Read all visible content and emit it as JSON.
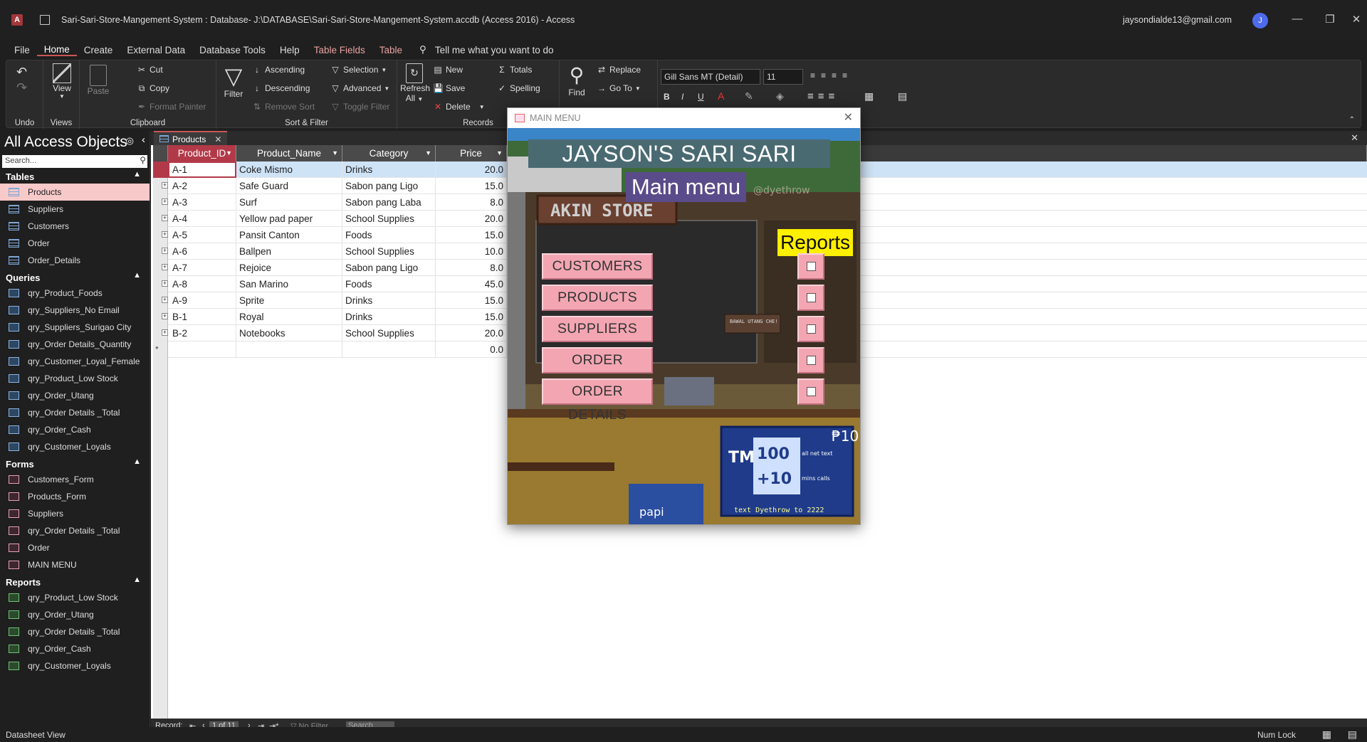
{
  "titlebar": {
    "app_badge": "A",
    "title": "Sari-Sari-Store-Mangement-System : Database- J:\\DATABASE\\Sari-Sari-Store-Mangement-System.accdb (Access 2016)  -  Access",
    "user": "jaysondialde13@gmail.com",
    "avatar": "J"
  },
  "menu": {
    "file": "File",
    "home": "Home",
    "create": "Create",
    "external": "External Data",
    "dbtools": "Database Tools",
    "help": "Help",
    "table_fields": "Table Fields",
    "table": "Table",
    "tell": "Tell me what you want to do"
  },
  "ribbon": {
    "undo_group": "Undo",
    "views_group": "Views",
    "view": "View",
    "clipboard_group": "Clipboard",
    "paste": "Paste",
    "cut": "Cut",
    "copy": "Copy",
    "format_painter": "Format Painter",
    "sortfilter_group": "Sort & Filter",
    "filter": "Filter",
    "ascending": "Ascending",
    "descending": "Descending",
    "remove_sort": "Remove Sort",
    "selection": "Selection",
    "advanced": "Advanced",
    "toggle_filter": "Toggle Filter",
    "records_group": "Records",
    "refresh": "Refresh",
    "refresh2": "All",
    "new": "New",
    "save": "Save",
    "delete": "Delete",
    "totals": "Totals",
    "spelling": "Spelling",
    "find": "Find",
    "replace": "Replace",
    "goto": "Go To",
    "font": "Gill Sans MT (Detail)",
    "size": "11"
  },
  "nav": {
    "header": "All Access Objects",
    "search_placeholder": "Search...",
    "tables_label": "Tables",
    "tables": [
      "Products",
      "Suppliers",
      "Customers",
      "Order",
      "Order_Details"
    ],
    "queries_label": "Queries",
    "queries": [
      "qry_Product_Foods",
      "qry_Suppliers_No Email",
      "qry_Suppliers_Surigao City",
      "qry_Order Details_Quantity",
      "qry_Customer_Loyal_Female",
      "qry_Product_Low Stock",
      "qry_Order_Utang",
      "qry_Order Details _Total",
      "qry_Order_Cash",
      "qry_Customer_Loyals"
    ],
    "forms_label": "Forms",
    "forms": [
      "Customers_Form",
      "Products_Form",
      "Suppliers",
      "qry_Order Details _Total",
      "Order",
      "MAIN MENU"
    ],
    "reports_label": "Reports",
    "reports": [
      "qry_Product_Low Stock",
      "qry_Order_Utang",
      "qry_Order Details _Total",
      "qry_Order_Cash",
      "qry_Customer_Loyals"
    ]
  },
  "doc_tab": "Products",
  "table": {
    "columns": [
      "Product_ID",
      "Product_Name",
      "Category",
      "Price"
    ],
    "rows": [
      [
        "A-1",
        "Coke Mismo",
        "Drinks",
        "20.0"
      ],
      [
        "A-2",
        "Safe Guard",
        "Sabon pang Ligo",
        "15.0"
      ],
      [
        "A-3",
        "Surf",
        "Sabon pang Laba",
        "8.0"
      ],
      [
        "A-4",
        "Yellow pad paper",
        "School Supplies",
        "20.0"
      ],
      [
        "A-5",
        "Pansit Canton",
        "Foods",
        "15.0"
      ],
      [
        "A-6",
        "Ballpen",
        "School Supplies",
        "10.0"
      ],
      [
        "A-7",
        "Rejoice",
        "Sabon pang Ligo",
        "8.0"
      ],
      [
        "A-8",
        "San Marino",
        "Foods",
        "45.0"
      ],
      [
        "A-9",
        "Sprite",
        "Drinks",
        "15.0"
      ],
      [
        "B-1",
        "Royal",
        "Drinks",
        "15.0"
      ],
      [
        "B-2",
        "Notebooks",
        "School Supplies",
        "20.0"
      ]
    ],
    "new_row_price": "0.0"
  },
  "recbar": {
    "label": "Record:",
    "position": "1 of 11",
    "nofilter": "No Filter",
    "search": "Search"
  },
  "status": {
    "left": "Datasheet View",
    "numlock": "Num Lock"
  },
  "form": {
    "title": "MAIN MENU",
    "store_name": "JAYSON'S SARI SARI STORE",
    "subtitle": "Main menu",
    "reports": "Reports",
    "sign": "AKIN STORE",
    "watermark": "@dyethrow",
    "buttons": [
      "CUSTOMERS",
      "PRODUCTS",
      "SUPPLIERS",
      "ORDER",
      "ORDER DETAILS"
    ],
    "ad_line1": "100",
    "ad_line2": "+10",
    "ad_note": "all net text",
    "ad_note2": "mins calls",
    "ad_footer": "text Dyethrow to 2222",
    "ad_price": "₱10",
    "ad_brand": "TM",
    "cooler": "papi",
    "utang": "BAWAL UTANG CHE!"
  },
  "colors": {
    "accent": "#b23a48",
    "nav_selected": "#f8c9c9",
    "menu_button": "#f3a6b2",
    "reports_bg": "#ffef00"
  }
}
